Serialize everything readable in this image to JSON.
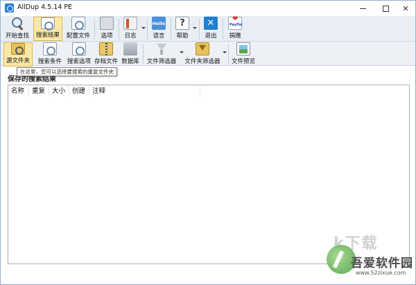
{
  "window": {
    "title": "AllDup 4.5.14 PE",
    "accent": "#fbe8a6"
  },
  "toolbar_main": {
    "items": [
      {
        "label": "开始查找",
        "icon": "search-icon"
      },
      {
        "label": "搜索结果",
        "icon": "search-results-icon",
        "active": true
      },
      {
        "label": "配置文件",
        "icon": "profile-icon"
      },
      {
        "label": "选项",
        "icon": "options-icon"
      },
      {
        "label": "日志",
        "icon": "log-icon"
      },
      {
        "label": "语言",
        "icon": "language-icon",
        "icon_text": "Hello"
      },
      {
        "label": "帮助",
        "icon": "help-icon",
        "icon_text": "?"
      },
      {
        "label": "退出",
        "icon": "exit-icon",
        "icon_text": "✕"
      },
      {
        "label": "捐赠",
        "icon": "donate-icon"
      }
    ]
  },
  "toolbar_sub": {
    "items": [
      {
        "label": "源文件夹",
        "icon": "source-folder-icon",
        "active": true
      },
      {
        "label": "搜索条件",
        "icon": "search-criteria-icon"
      },
      {
        "label": "搜索选项",
        "icon": "search-options-icon"
      },
      {
        "label": "存档文件",
        "icon": "archive-icon"
      },
      {
        "label": "数据库",
        "icon": "database-icon"
      },
      {
        "label": "文件筛选器",
        "icon": "file-filter-icon"
      },
      {
        "label": "文件夹筛选器",
        "icon": "folder-filter-icon"
      },
      {
        "label": "文件预览",
        "icon": "file-preview-icon"
      }
    ]
  },
  "tooltip": "在这里，您可以选择要搜索的重复文件夹",
  "section_title": "保存的搜索结果",
  "results": {
    "columns": [
      "名称",
      "重复",
      "大小",
      "创建",
      "注释"
    ]
  },
  "watermark": {
    "brand": "吾爱软件园",
    "url": "www.52zixue.com",
    "big": "k下载"
  }
}
